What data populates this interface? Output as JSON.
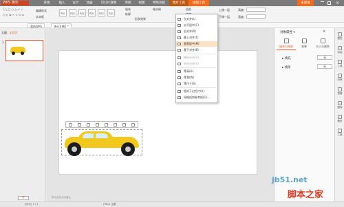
{
  "app": {
    "logo": "WPS 演示",
    "title": ""
  },
  "tabs": [
    "开始",
    "插入",
    "设计",
    "动画",
    "幻灯片放映",
    "审阅",
    "视图",
    "特色功能",
    "图片工具",
    "绘图工具"
  ],
  "tab_right": "未登录",
  "ribbon": {
    "shape_labels": [
      "Abc",
      "Abc",
      "Abc",
      "Abc",
      "Abc",
      "Abc"
    ],
    "left": [
      "编辑形状",
      "文本框"
    ],
    "fill": "填充",
    "outline": "轮廓",
    "effect": "形状效果",
    "format_brush": "格式刷",
    "combine": "组合",
    "rotate": "旋转",
    "align": "对齐",
    "select_pane": "选择窗格",
    "bring_forward": "上移一层",
    "send_backward": "下移一层",
    "height_label": "高度:",
    "height_val": "",
    "width_label": "宽度:",
    "width_val": ""
  },
  "doc_tabs": [
    "我的WPS",
    "演示文稿1 *"
  ],
  "leftpanel": {
    "tabs": [
      "大纲",
      "幻灯片"
    ],
    "slide_no": "1"
  },
  "menu": {
    "items": [
      {
        "label": "左对齐(L)",
        "dis": false
      },
      {
        "label": "水平居中(C)",
        "dis": false
      },
      {
        "label": "右对齐(R)",
        "dis": false
      },
      {
        "label": "靠上对齐(T)",
        "dis": false
      },
      {
        "label": "垂直居中(M)",
        "dis": false,
        "hl": true
      },
      {
        "label": "靠下对齐(B)",
        "dis": false
      },
      {
        "label": "横向分布(H)",
        "dis": true
      },
      {
        "label": "纵向分布(V)",
        "dis": true
      },
      {
        "label": "等高(H)",
        "dis": false
      },
      {
        "label": "等宽(W)",
        "dis": false
      },
      {
        "label": "等尺寸(S)",
        "dis": false
      },
      {
        "label": "相对于幻灯片(A)",
        "dis": false
      },
      {
        "label": "网格线和参考线(G)...",
        "dis": false
      }
    ]
  },
  "rightpanel": {
    "title": "对象属性 ▾",
    "tabs": [
      "填充与线条",
      "效果",
      "大小与属性"
    ],
    "fill": "填充",
    "line": "线条",
    "fill_val": "无",
    "line_val": "无"
  },
  "sidebar": [
    "属性",
    "动画",
    "工具",
    "分享",
    "剪辑",
    "图库",
    "备份",
    "工具"
  ],
  "status": {
    "left": "幻灯片 1 / 1",
    "theme": "Office 主题",
    "hint": "单击此处添加备注"
  },
  "watermark": {
    "domain": "jb51.net",
    "cn": "脚本之家"
  },
  "colors": {
    "accent": "#f26b1d",
    "car": "#f2c81c"
  }
}
